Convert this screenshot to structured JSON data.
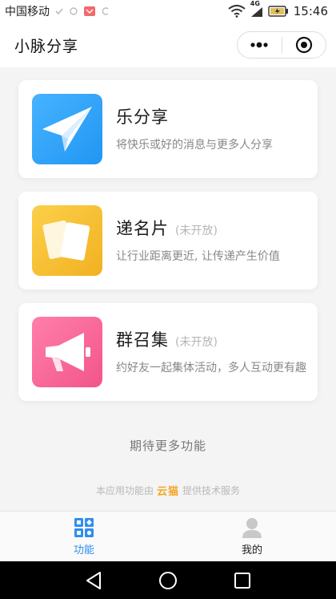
{
  "status_bar": {
    "carrier": "中国移动",
    "network": "4G",
    "time": "15:46"
  },
  "header": {
    "title": "小脉分享"
  },
  "cards": [
    {
      "title": "乐分享",
      "badge": "",
      "description": "将快乐或好的消息与更多人分享",
      "icon": "paper-plane-icon",
      "color": "#35a4f5"
    },
    {
      "title": "递名片",
      "badge": "(未开放)",
      "description": "让行业距离更近, 让传递产生价值",
      "icon": "business-card-icon",
      "color": "#f7c23b"
    },
    {
      "title": "群召集",
      "badge": "(未开放)",
      "description": "约好友一起集体活动，多人互动更有趣",
      "icon": "megaphone-icon",
      "color": "#f66a9a"
    }
  ],
  "more_functions": "期待更多功能",
  "footer": {
    "prefix": "本应用功能由",
    "brand": "云猫",
    "suffix": "提供技术服务"
  },
  "tabs": [
    {
      "label": "功能",
      "icon": "grid-icon",
      "active": true
    },
    {
      "label": "我的",
      "icon": "user-icon",
      "active": false
    }
  ],
  "colors": {
    "accent": "#2f8ef0",
    "brand": "#f5a623"
  }
}
